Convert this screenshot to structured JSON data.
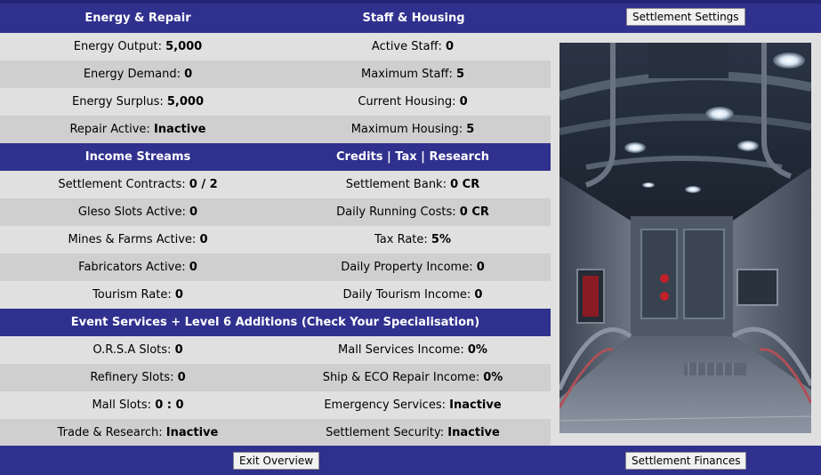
{
  "header": {
    "energy_title": "Energy & Repair",
    "staff_title": "Staff & Housing",
    "settings_button": "Settlement Settings"
  },
  "energy_staff_rows": [
    {
      "l_label": "Energy Output:",
      "l_value": "5,000",
      "r_label": "Active Staff:",
      "r_value": "0"
    },
    {
      "l_label": "Energy Demand:",
      "l_value": "0",
      "r_label": "Maximum Staff:",
      "r_value": "5"
    },
    {
      "l_label": "Energy Surplus:",
      "l_value": "5,000",
      "r_label": "Current Housing:",
      "r_value": "0"
    },
    {
      "l_label": "Repair Active:",
      "l_value": "Inactive",
      "r_label": "Maximum Housing:",
      "r_value": "5"
    }
  ],
  "income_section": {
    "left_title": "Income Streams",
    "right_title": "Credits | Tax | Research"
  },
  "income_rows": [
    {
      "l_label": "Settlement Contracts:",
      "l_value": "0 / 2",
      "r_label": "Settlement Bank:",
      "r_value": "0 CR"
    },
    {
      "l_label": "Gleso Slots Active:",
      "l_value": "0",
      "r_label": "Daily Running Costs:",
      "r_value": "0 CR"
    },
    {
      "l_label": "Mines & Farms Active:",
      "l_value": "0",
      "r_label": "Tax Rate:",
      "r_value": "5%"
    },
    {
      "l_label": "Fabricators Active:",
      "l_value": "0",
      "r_label": "Daily Property Income:",
      "r_value": "0"
    },
    {
      "l_label": "Tourism Rate:",
      "l_value": "0",
      "r_label": "Daily Tourism Income:",
      "r_value": "0"
    }
  ],
  "event_section": {
    "title": "Event Services + Level 6 Additions (Check Your Specialisation)"
  },
  "event_rows": [
    {
      "l_label": "O.R.S.A Slots:",
      "l_value": "0",
      "r_label": "Mall Services Income:",
      "r_value": "0%"
    },
    {
      "l_label": "Refinery Slots:",
      "l_value": "0",
      "r_label": "Ship & ECO Repair Income:",
      "r_value": "0%"
    },
    {
      "l_label": "Mall Slots:",
      "l_value": "0 : 0",
      "r_label": "Emergency Services:",
      "r_value": "Inactive"
    },
    {
      "l_label": "Trade & Research:",
      "l_value": "Inactive",
      "r_label": "Settlement Security:",
      "r_value": "Inactive"
    }
  ],
  "footer": {
    "exit_button": "Exit Overview",
    "finances_button": "Settlement Finances"
  }
}
